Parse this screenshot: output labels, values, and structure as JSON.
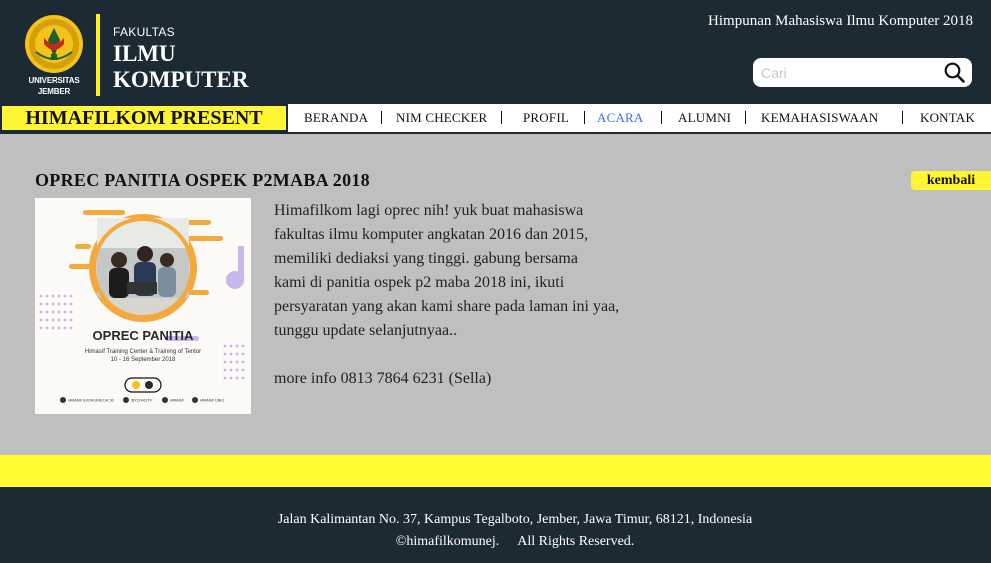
{
  "header": {
    "logo_text_1": "UNIVERSITAS",
    "logo_text_2": "JEMBER",
    "faculty_small": "FAKULTAS",
    "faculty_line1": "ILMU",
    "faculty_line2": "KOMPUTER",
    "org_title": "Himpunan Mahasiswa Ilmu Komputer 2018",
    "search_placeholder": "Cari"
  },
  "nav": {
    "present_label": "HIMAFILKOM PRESENT",
    "items": [
      {
        "label": "BERANDA"
      },
      {
        "label": "NIM CHECKER"
      },
      {
        "label": "PROFIL"
      },
      {
        "label": "ACARA"
      },
      {
        "label": "ALUMNI"
      },
      {
        "label": "KEMAHASISWAAN"
      },
      {
        "label": "KONTAK"
      }
    ],
    "active_index": 3
  },
  "post": {
    "title": "OPREC PANITIA OSPEK P2MABA 2018",
    "back_label": "kembali",
    "paragraphs": [
      "Himafilkom lagi oprec nih! yuk buat mahasiswa",
      "fakultas ilmu komputer angkatan 2016 dan 2015,",
      "memiliki dediaksi yang tinggi. gabung bersama",
      "kami di panitia ospek p2 maba 2018 ini, ikuti",
      "persyaratan yang akan kami share pada laman ini yaa,",
      "tunggu update selanjutnyaa.."
    ],
    "contact": "more info 0813 7864 6231 (Sella)",
    "poster": {
      "heading": "OPREC PANITIA",
      "sub1": "Himasif Training Center & Training of Tentor",
      "sub2": "10 - 16 September 2018",
      "social": [
        "HIMASIF.ILKOM.UNEJ.AC.ID",
        "@YZO412TF",
        "HIMASIF",
        "HIMASIF UNEJ"
      ]
    }
  },
  "footer": {
    "address": "Jalan Kalimantan No. 37, Kampus Tegalboto, Jember, Jawa Timur, 68121, Indonesia",
    "copyright": "©himafilkomunej.",
    "rights": "All Rights Reserved."
  },
  "colors": {
    "header_bg": "#1b2a33",
    "accent_yellow": "#fff532",
    "active_nav": "#3b6ee8",
    "page_bg": "#bfbfbf"
  }
}
